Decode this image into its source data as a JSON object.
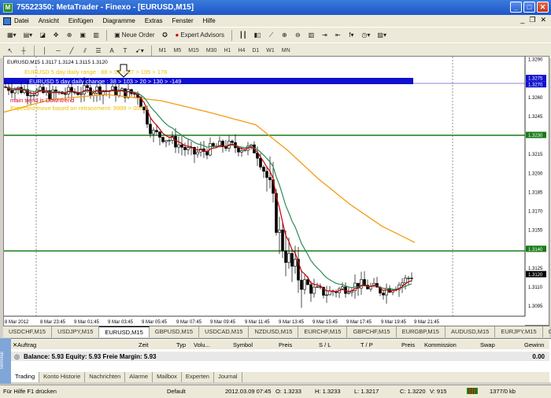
{
  "window": {
    "title": "75522350: MetaTrader - Finexo - [EURUSD,M15]"
  },
  "menu": [
    "Datei",
    "Ansicht",
    "Einfügen",
    "Diagramme",
    "Extras",
    "Fenster",
    "Hilfe"
  ],
  "toolbar": {
    "new_order": "Neue Order",
    "expert_advisors": "Expert Advisors"
  },
  "timeframes": [
    "M1",
    "M5",
    "M15",
    "M30",
    "H1",
    "H4",
    "D1",
    "W1",
    "MN"
  ],
  "chart": {
    "header": "EURUSD,M15  1.3117 1.3124 1.3115 1.3120",
    "ind_text1": "EURUSD 5 day daily range : 88 > 93 > 87 > 105 > 176",
    "ind_text2": "EURUSD 5 day daily change : 38 > 103 > 20 > 130 > -149",
    "ind_text3": "main trend is Downtrend",
    "ind_text4": "Expected move based on retracement:  9999 > 000 = ",
    "price_labels": [
      "1.3290",
      "1.3275",
      "1.3270",
      "1.3260",
      "1.3245",
      "1.3230",
      "1.3215",
      "1.3200",
      "1.3185",
      "1.3170",
      "1.3155",
      "1.3140",
      "1.3125",
      "1.3120",
      "1.3110",
      "1.3095"
    ],
    "time_labels": [
      "8 Mar 2012",
      "8 Mar 23:45",
      "9 Mar 01:45",
      "9 Mar 03:45",
      "9 Mar 05:45",
      "9 Mar 07:45",
      "9 Mar 09:45",
      "9 Mar 11:45",
      "9 Mar 13:45",
      "9 Mar 15:45",
      "9 Mar 17:45",
      "9 Mar 19:45",
      "9 Mar 21:45"
    ],
    "colors": {
      "red_ma": "#c00000",
      "green_ma": "#2e8b57",
      "orange_ma": "#f39c12",
      "hline": "#1a7a1a",
      "blue_band": "#1010d0"
    }
  },
  "symbol_tabs": [
    "USDCHF,M15",
    "USDJPY,M15",
    "EURUSD,M15",
    "GBPUSD,M15",
    "USDCAD,M15",
    "NZDUSD,M15",
    "EURCHF,M15",
    "GBPCHF,M15",
    "EURGBP,M15",
    "AUDUSD,M15",
    "EURJPY,M15",
    "GBPJ"
  ],
  "terminal": {
    "columns": [
      "Auftrag",
      "Zeit",
      "Typ",
      "Volu...",
      "Symbol",
      "Preis",
      "S / L",
      "T / P",
      "Preis",
      "Kommission",
      "Swap",
      "Gewinn"
    ],
    "balance": "Balance: 5.93  Equity: 5.93  Freie Margin: 5.93",
    "profit": "0.00",
    "tabs": [
      "Trading",
      "Konto Historie",
      "Nachrichten",
      "Alarme",
      "Mailbox",
      "Experten",
      "Journal"
    ],
    "side_label": "Terminal"
  },
  "status": {
    "help": "Für Hilfe F1 drücken",
    "profile": "Default",
    "datetime": "2012.03.09 07:45",
    "open": "O: 1.3233",
    "high": "H: 1.3233",
    "low": "L: 1.3217",
    "close": "C: 1.3220",
    "volume": "V: 915",
    "traffic": "1377/0 kb"
  }
}
